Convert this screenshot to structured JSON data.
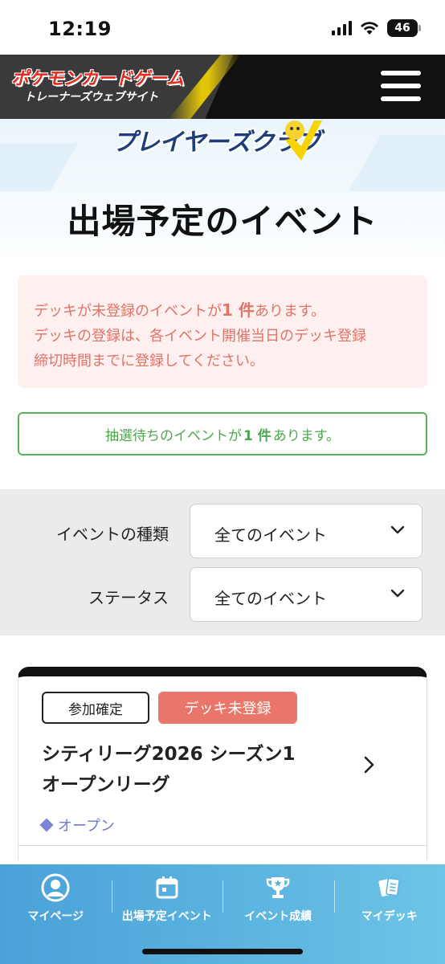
{
  "status_bar": {
    "time": "12:19",
    "battery": "46"
  },
  "header": {
    "logo_main": "ポケモンカードゲーム",
    "logo_sub": "トレーナーズウェブサイト",
    "menu_icon": "hamburger-menu-icon"
  },
  "hero": {
    "club_logo": "プレイヤーズクラブ",
    "title": "出場予定のイベント"
  },
  "alerts": {
    "deck_unregistered": {
      "prefix": "デッキが未登録のイベントが",
      "count": "1 件",
      "suffix": "あります。",
      "line2": "デッキの登録は、各イベント開催当日のデッキ登録",
      "line3": "締切時間までに登録してください。",
      "color": "#e0736a"
    },
    "lottery_waiting": {
      "prefix": "抽選待ちのイベントが",
      "count": "1 件",
      "suffix": "あります。",
      "color": "#4ea84f"
    }
  },
  "filters": {
    "event_type": {
      "label": "イベントの種類",
      "value": "全てのイベント"
    },
    "status": {
      "label": "ステータス",
      "value": "全てのイベント"
    }
  },
  "events": [
    {
      "badge_confirmed": "参加確定",
      "badge_deck": "デッキ未登録",
      "title_line1": "シティリーグ2026 シーズン1",
      "title_line2": "オープンリーグ",
      "type": "オープン"
    }
  ],
  "bottom_nav": {
    "items": [
      {
        "label": "マイページ",
        "icon": "user-avatar-icon"
      },
      {
        "label": "出場予定イベント",
        "icon": "calendar-icon"
      },
      {
        "label": "イベント成績",
        "icon": "trophy-icon"
      },
      {
        "label": "マイデッキ",
        "icon": "cards-icon"
      }
    ]
  },
  "colors": {
    "header_bg": "#111111",
    "accent_yellow": "#f5d400",
    "deck_badge": "#ea766b",
    "nav_bg": "#4aa1d8",
    "type_color": "#6f79cf"
  }
}
